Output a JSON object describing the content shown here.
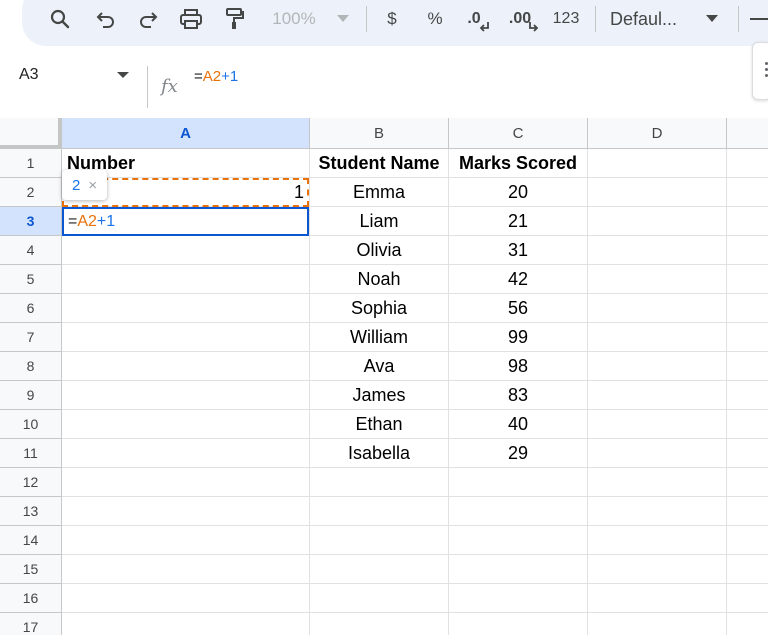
{
  "toolbar": {
    "zoom": "100%",
    "currency": "$",
    "percent": "%",
    "decrease_decimal": ".0",
    "increase_decimal": ".00",
    "number_format": "123",
    "font": "Defaul..."
  },
  "formula_bar": {
    "cell_ref": "A3",
    "fx": "fx",
    "formula_eq": "=",
    "formula_ref": "A2",
    "formula_op": "+",
    "formula_num": "1"
  },
  "columns": [
    "A",
    "B",
    "C",
    "D"
  ],
  "rows": [
    "1",
    "2",
    "3",
    "4",
    "5",
    "6",
    "7",
    "8",
    "9",
    "10",
    "11",
    "12",
    "13",
    "14",
    "15",
    "16",
    "17"
  ],
  "cells": {
    "A1": "Number",
    "B1": "Student Name",
    "C1": "Marks Scored",
    "A2": "1",
    "students": [
      {
        "name": "Emma",
        "marks": "20"
      },
      {
        "name": "Liam",
        "marks": "21"
      },
      {
        "name": "Olivia",
        "marks": "31"
      },
      {
        "name": "Noah",
        "marks": "42"
      },
      {
        "name": "Sophia",
        "marks": "56"
      },
      {
        "name": "William",
        "marks": "99"
      },
      {
        "name": "Ava",
        "marks": "98"
      },
      {
        "name": "James",
        "marks": "83"
      },
      {
        "name": "Ethan",
        "marks": "40"
      },
      {
        "name": "Isabella",
        "marks": "29"
      }
    ]
  },
  "editor": {
    "eq": "=",
    "ref": "A2",
    "op": "+",
    "num": "1"
  },
  "tooltip": {
    "value": "2",
    "close": "×"
  },
  "selection": {
    "active_cell": "A3",
    "active_column": "A",
    "active_row": "3"
  },
  "colors": {
    "ref_orange": "#e8710a",
    "ref_blue": "#1a73e8",
    "selection_blue": "#0b57d0",
    "header_highlight": "#d3e3fd"
  }
}
